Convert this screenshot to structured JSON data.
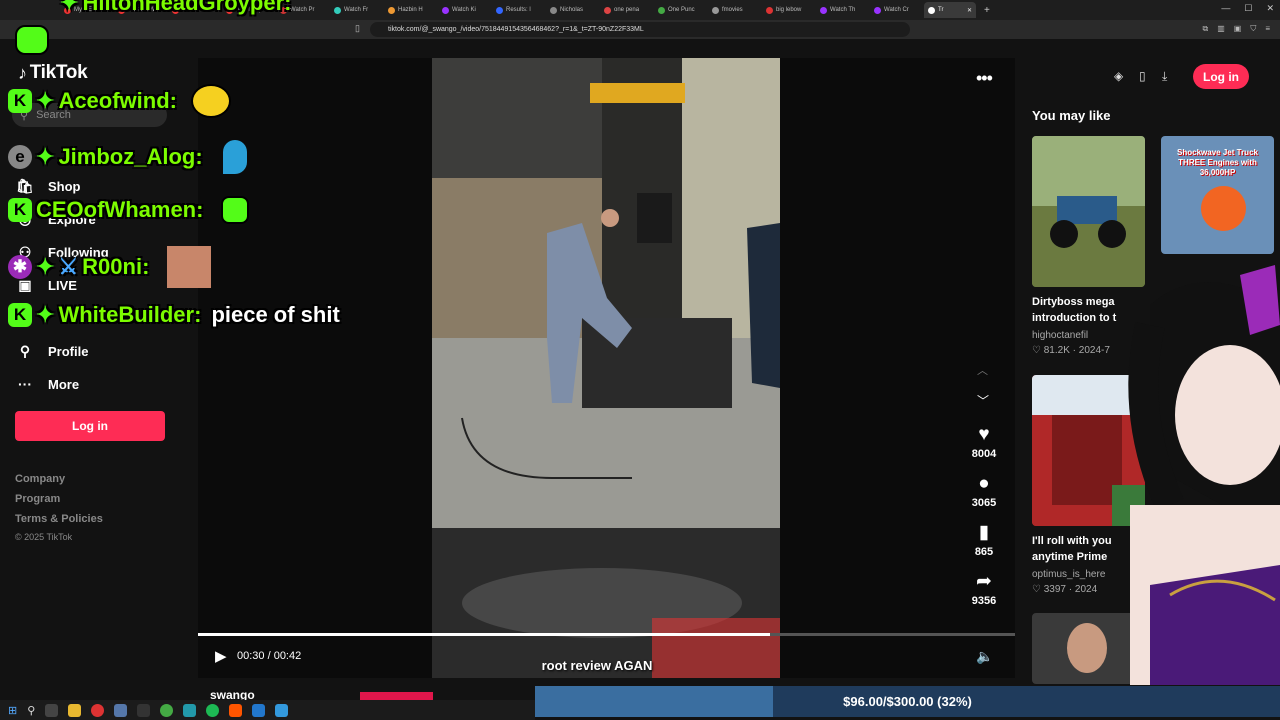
{
  "browser": {
    "url": "tiktok.com/@_swango_/video/7518449154356468462?_r=1&_t=ZT-90nZ22F33ML",
    "tabs": [
      {
        "label": "My NEW"
      },
      {
        "label": "This NEW"
      },
      {
        "label": "Bill O'Reil"
      },
      {
        "label": "Ana Kasp"
      },
      {
        "label": "Watch Pr"
      },
      {
        "label": "Watch Fr"
      },
      {
        "label": "Hazbin H"
      },
      {
        "label": "Watch Ki"
      },
      {
        "label": "Results: l"
      },
      {
        "label": "Nicholas"
      },
      {
        "label": "one pena"
      },
      {
        "label": "One Punc"
      },
      {
        "label": "fmovies"
      },
      {
        "label": "big lebow"
      },
      {
        "label": "Watch Th"
      },
      {
        "label": "Watch Cr"
      },
      {
        "label": "Tr"
      }
    ]
  },
  "sidebar": {
    "logo": "TikTok",
    "search_placeholder": "Search",
    "nav": [
      {
        "label": "Shop",
        "icon": "shop-icon"
      },
      {
        "label": "Explore",
        "icon": "compass-icon"
      },
      {
        "label": "Following",
        "icon": "following-icon"
      },
      {
        "label": "LIVE",
        "icon": "live-icon"
      },
      {
        "label": "Profile",
        "icon": "profile-icon"
      },
      {
        "label": "More",
        "icon": "more-icon"
      }
    ],
    "login": "Log in",
    "footer": [
      "Company",
      "Program",
      "Terms & Policies"
    ],
    "copyright": "© 2025 TikTok"
  },
  "header": {
    "login": "Log in"
  },
  "video": {
    "time": "00:30 / 00:42",
    "progress": 0.7,
    "caption": "root review AGAN",
    "author": "swango"
  },
  "actions": [
    {
      "icon": "heart-icon",
      "count": "8004"
    },
    {
      "icon": "comment-icon",
      "count": "3065"
    },
    {
      "icon": "bookmark-icon",
      "count": "865"
    },
    {
      "icon": "share-icon",
      "count": "9356"
    }
  ],
  "recommendations": {
    "heading": "You may like",
    "items": [
      {
        "title": "Dirtyboss mega introduction to t",
        "author": "highoctanefil",
        "likes": "81.2K",
        "date": "2024-7"
      },
      {
        "title": "I'll roll with you anytime Prime",
        "author": "optimus_is_here",
        "likes": "3397",
        "date": "2024"
      }
    ],
    "thumb2_text": "Shockwave Jet Truck THREE Engines with 36,000HP"
  },
  "chat": [
    {
      "user": "HiltonHeadGroyper:",
      "msg": ""
    },
    {
      "user": "Aceofwind:",
      "msg": ""
    },
    {
      "user": "Jimboz_Alog:",
      "msg": ""
    },
    {
      "user": "CEOofWhamen:",
      "msg": ""
    },
    {
      "user": "R00ni:",
      "msg": ""
    },
    {
      "user": "WhiteBuilder:",
      "msg": "piece of shit"
    }
  ],
  "donation_goal": {
    "text": "$96.00/$300.00 (32%)",
    "fraction": 0.32
  },
  "colors": {
    "accent": "#fe2c55",
    "chat_green": "#7cfc00",
    "kick_green": "#53fc18"
  }
}
